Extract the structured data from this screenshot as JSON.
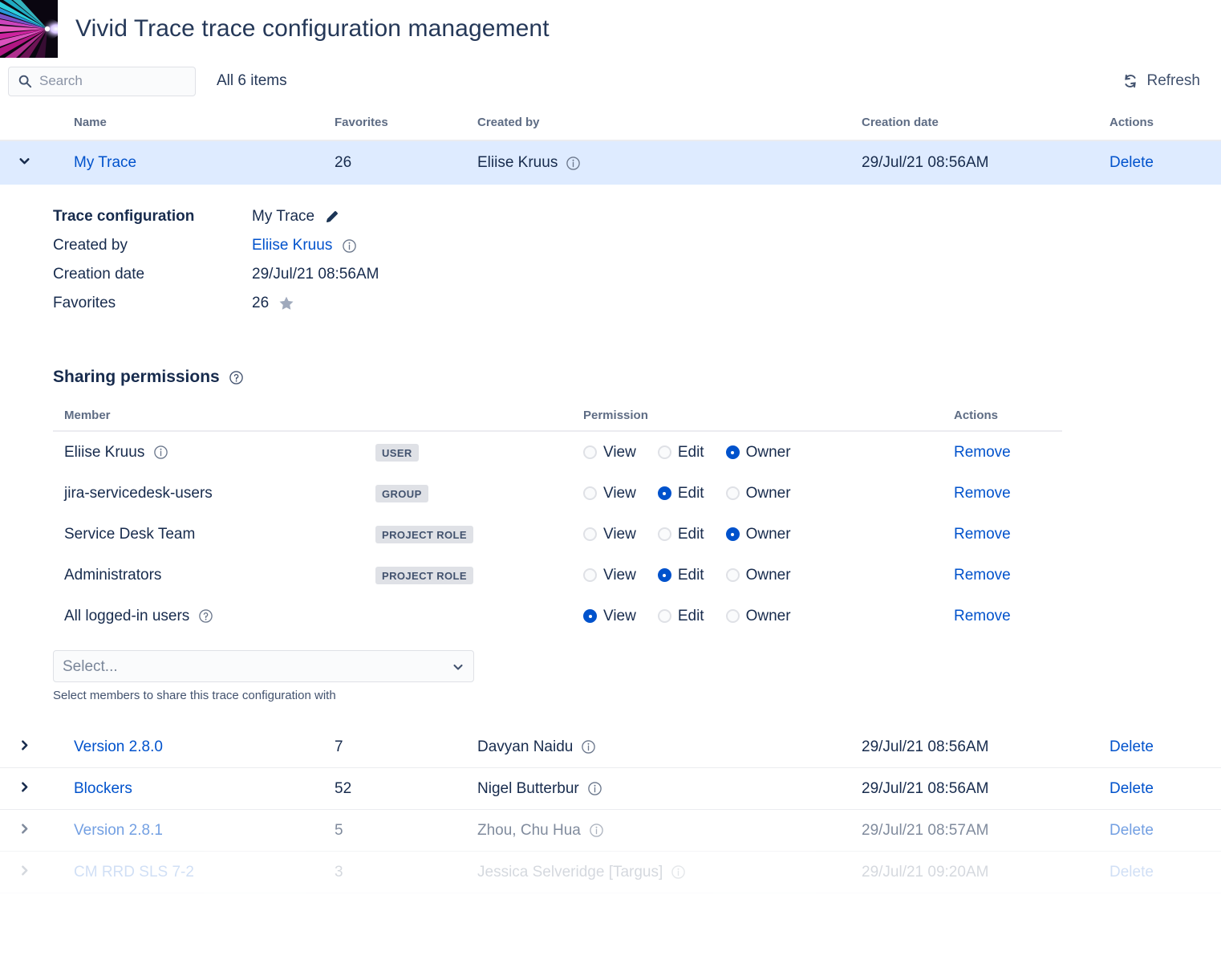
{
  "header": {
    "title": "Vivid Trace trace configuration management",
    "logo_icon": "light-rays-logo"
  },
  "toolbar": {
    "search_placeholder": "Search",
    "search_value": "",
    "search_icon": "search-icon",
    "items_count": "All 6 items",
    "refresh_label": "Refresh",
    "refresh_icon": "refresh-icon"
  },
  "main_table": {
    "columns": [
      "Name",
      "Favorites",
      "Created by",
      "Creation date",
      "Actions"
    ],
    "rows": [
      {
        "name": "My Trace",
        "favorites": "26",
        "created_by": "Eliise Kruus",
        "creation_date": "29/Jul/21 08:56AM",
        "action": "Delete",
        "expanded": true
      },
      {
        "name": "Version 2.8.0",
        "favorites": "7",
        "created_by": "Davyan Naidu",
        "creation_date": "29/Jul/21 08:56AM",
        "action": "Delete",
        "expanded": false
      },
      {
        "name": "Blockers",
        "favorites": "52",
        "created_by": "Nigel Butterbur",
        "creation_date": "29/Jul/21 08:56AM",
        "action": "Delete",
        "expanded": false
      },
      {
        "name": "Version 2.8.1",
        "favorites": "5",
        "created_by": "Zhou, Chu Hua",
        "creation_date": "29/Jul/21 08:57AM",
        "action": "Delete",
        "expanded": false
      },
      {
        "name": "CM RRD SLS 7-2",
        "favorites": "3",
        "created_by": "Jessica Selveridge [Targus]",
        "creation_date": "29/Jul/21 09:20AM",
        "action": "Delete",
        "expanded": false
      }
    ]
  },
  "detail": {
    "trace_config_label": "Trace configuration",
    "trace_config_value": "My Trace",
    "edit_icon": "pencil-icon",
    "created_by_label": "Created by",
    "created_by_value": "Eliise Kruus",
    "creation_date_label": "Creation date",
    "creation_date_value": "29/Jul/21 08:56AM",
    "favorites_label": "Favorites",
    "favorites_value": "26",
    "star_icon": "star-icon",
    "info_icon": "info-icon"
  },
  "sharing": {
    "title": "Sharing permissions",
    "help_icon": "help-icon",
    "columns": [
      "Member",
      "Permission",
      "Actions"
    ],
    "permission_options": [
      "View",
      "Edit",
      "Owner"
    ],
    "remove_label": "Remove",
    "rows": [
      {
        "member": "Eliise Kruus",
        "has_info": true,
        "has_help": false,
        "badge": "USER",
        "permission": "Owner"
      },
      {
        "member": "jira-servicedesk-users",
        "has_info": false,
        "has_help": false,
        "badge": "GROUP",
        "permission": "Edit"
      },
      {
        "member": "Service Desk Team",
        "has_info": false,
        "has_help": false,
        "badge": "PROJECT ROLE",
        "permission": "Owner"
      },
      {
        "member": "Administrators",
        "has_info": false,
        "has_help": false,
        "badge": "PROJECT ROLE",
        "permission": "Edit"
      },
      {
        "member": "All logged-in users",
        "has_info": false,
        "has_help": true,
        "badge": "",
        "permission": "View"
      }
    ],
    "select_placeholder": "Select...",
    "select_options": [
      "Select..."
    ],
    "select_hint": "Select members to share this trace configuration with"
  },
  "colors": {
    "link": "#0052CC",
    "selected_row_bg": "#DEEBFF",
    "badge_bg": "#DFE1E6",
    "heading": "#5E6C84",
    "text": "#172B4D"
  }
}
